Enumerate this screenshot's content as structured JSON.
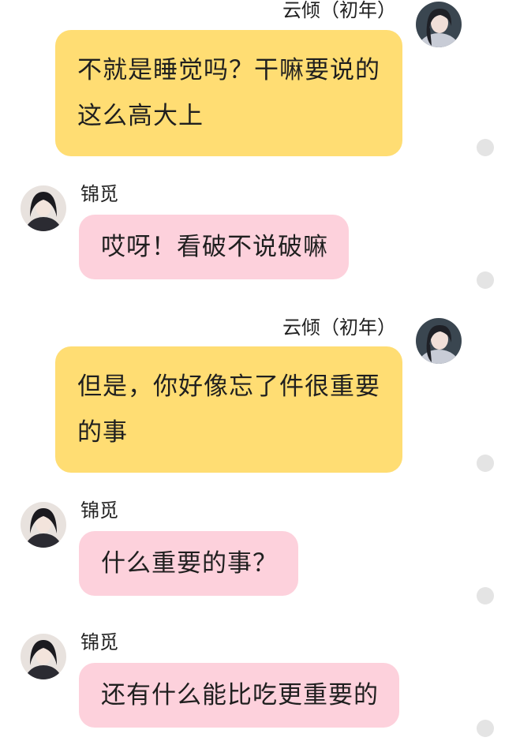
{
  "colors": {
    "outgoing_bubble": "#ffdd73",
    "incoming_bubble": "#fdd1dc",
    "background": "#ffffff",
    "dot": "#e4e4e4"
  },
  "messages": [
    {
      "sender": "云倾（初年）",
      "text": "不就是睡觉吗？干嘛要说的这么高大上",
      "side": "right"
    },
    {
      "sender": "锦觅",
      "text": "哎呀！看破不说破嘛",
      "side": "left"
    },
    {
      "sender": "云倾（初年）",
      "text": "但是，你好像忘了件很重要的事",
      "side": "right"
    },
    {
      "sender": "锦觅",
      "text": "什么重要的事？",
      "side": "left"
    },
    {
      "sender": "锦觅",
      "text": "还有什么能比吃更重要的",
      "side": "left"
    }
  ]
}
